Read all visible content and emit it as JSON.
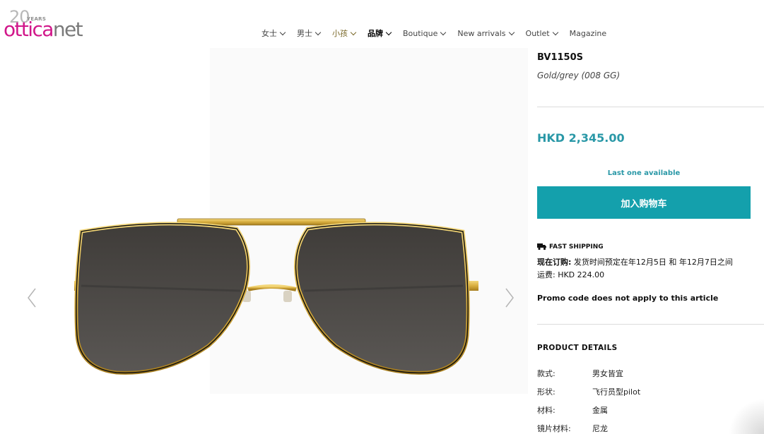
{
  "logo": {
    "anniversary": "20",
    "years": "YEARS",
    "brand_part1": "ottica",
    "brand_part2": "net"
  },
  "nav": {
    "items": [
      {
        "label": "女士",
        "dropdown": true
      },
      {
        "label": "男士",
        "dropdown": true
      },
      {
        "label": "小孩",
        "dropdown": true
      },
      {
        "label": "品牌",
        "dropdown": true
      },
      {
        "label": "Boutique",
        "dropdown": true
      },
      {
        "label": "New arrivals",
        "dropdown": true
      },
      {
        "label": "Outlet",
        "dropdown": true
      },
      {
        "label": "Magazine",
        "dropdown": false
      }
    ]
  },
  "gallery": {
    "prev_icon": "chevron-left-icon",
    "next_icon": "chevron-right-icon"
  },
  "product": {
    "model": "BV1150S",
    "variant": "Gold/grey (008 GG)",
    "price": "HKD 2,345.00",
    "stock": "Last one available",
    "add_to_cart": "加入购物车"
  },
  "shipping": {
    "title": "FAST SHIPPING",
    "order_label": "现在订购:",
    "order_text": " 发货时间预定在年12月5日 和 年12月7日之间",
    "cost": "运费: HKD 224.00"
  },
  "promo": "Promo code does not apply to this article",
  "details": {
    "title": "PRODUCT DETAILS",
    "rows": [
      {
        "key": "款式:",
        "value": "男女皆宜"
      },
      {
        "key": "形状:",
        "value": "飞行员型pilot"
      },
      {
        "key": "材料:",
        "value": "金属"
      },
      {
        "key": "镜片材料:",
        "value": "尼龙"
      }
    ]
  },
  "colors": {
    "accent": "#14a0ac",
    "price": "#2a98a7",
    "brand_pink": "#d1178a",
    "brand_grey": "#7a7a7a"
  }
}
